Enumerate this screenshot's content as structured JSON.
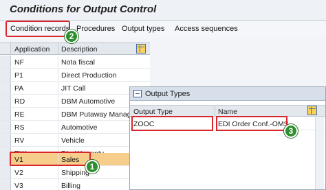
{
  "page": {
    "title": "Conditions for Output Control"
  },
  "toolbar": {
    "items": [
      "Condition records",
      "Procedures",
      "Output types",
      "Access sequences"
    ]
  },
  "table": {
    "columns": [
      "Application",
      "Description"
    ],
    "rows": [
      {
        "app": "NF",
        "desc": "Nota fiscal"
      },
      {
        "app": "P1",
        "desc": "Direct Production"
      },
      {
        "app": "PA",
        "desc": "JIT Call"
      },
      {
        "app": "RD",
        "desc": "DBM Automotive"
      },
      {
        "app": "RE",
        "desc": "DBM Putaway Manage"
      },
      {
        "app": "RS",
        "desc": "Automotive"
      },
      {
        "app": "RV",
        "desc": "Vehicle"
      },
      {
        "app": "RW",
        "desc": "DI - Warranty"
      },
      {
        "app": "V1",
        "desc": "Sales"
      },
      {
        "app": "V2",
        "desc": "Shipping"
      },
      {
        "app": "V3",
        "desc": "Billing"
      }
    ],
    "selected_row": "V1"
  },
  "dialog": {
    "title": "Output Types",
    "columns": [
      "Output Type",
      "Name"
    ],
    "rows": [
      {
        "type": "ZOOC",
        "name": "EDI Order Conf.-OMS"
      }
    ]
  },
  "steps": [
    "1",
    "2",
    "3"
  ],
  "colors": {
    "highlight": "#d9262c",
    "step_badge": "#2f8f2e",
    "selected_row": "#f7cd8c"
  }
}
